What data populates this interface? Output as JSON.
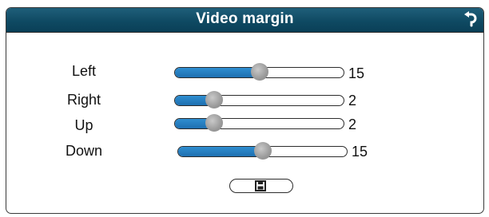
{
  "dialog": {
    "title": "Video margin",
    "back_icon": "return-arrow-icon",
    "save_icon": "floppy-disk-icon"
  },
  "margins": [
    {
      "label": "Left",
      "value": "15",
      "fraction": 0.5
    },
    {
      "label": "Right",
      "value": "2",
      "fraction": 0.23
    },
    {
      "label": "Up",
      "value": "2",
      "fraction": 0.23
    },
    {
      "label": "Down",
      "value": "15",
      "fraction": 0.5
    }
  ],
  "colors": {
    "titlebar": "#0f4a63",
    "slider_fill": "#1e6fb0",
    "knob": "#9a9a9a"
  }
}
